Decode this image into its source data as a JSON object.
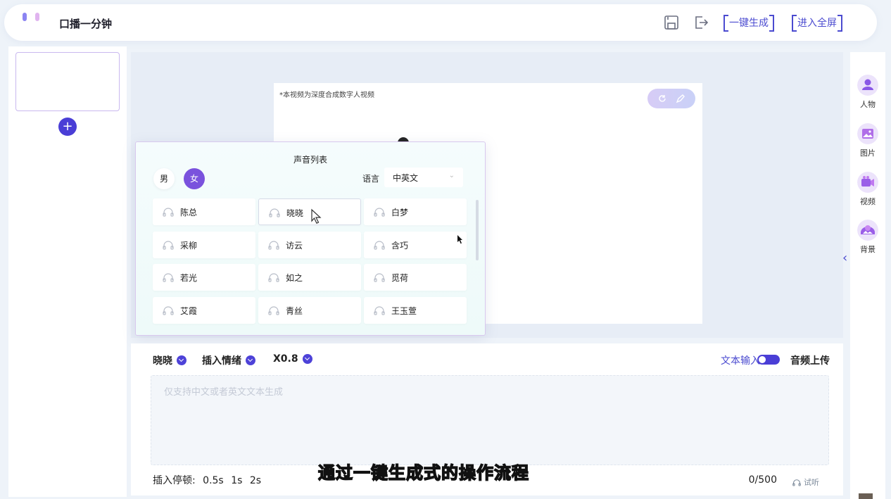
{
  "header": {
    "title": "口播一分钟",
    "generate_label": "一键生成",
    "fullscreen_label": "进入全屏"
  },
  "canvas": {
    "video_note": "*本视频为深度合成数字人视频"
  },
  "voice_popup": {
    "title": "声音列表",
    "gender_male": "男",
    "gender_female": "女",
    "language_label": "语言",
    "language_value": "中英文",
    "voices": [
      "陈总",
      "晓晓",
      "白梦",
      "采柳",
      "访云",
      "含巧",
      "若光",
      "如之",
      "觅荷",
      "艾霞",
      "青丝",
      "王玉萱"
    ],
    "selected_voice": "晓晓"
  },
  "editor": {
    "voice_name": "晓晓",
    "emotion_label": "插入情绪",
    "speed_label": "X0.8",
    "mode_text": "文本输入",
    "mode_audio": "音频上传",
    "text_placeholder": "仅支持中文或者英文文本生成",
    "pause_label": "插入停顿:",
    "pause_options": [
      "0.5s",
      "1s",
      "2s"
    ],
    "char_count": "0/500",
    "try_listen": "试听"
  },
  "right_bar": {
    "items": [
      "人物",
      "图片",
      "视频",
      "背景"
    ]
  },
  "subtitle": "通过一键生成式的操作流程",
  "colors": {
    "accent": "#4b4bd0",
    "accent_dark": "#4a3ed6",
    "female_active": "#7a52dd"
  }
}
